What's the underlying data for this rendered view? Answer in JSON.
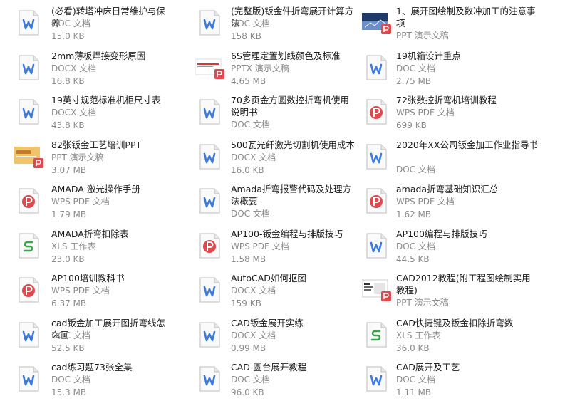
{
  "files": [
    {
      "title": "(必看)转塔冲床日常维护与保养",
      "type": "DOC 文档",
      "size": "15.0 KB",
      "icon": "word-doc-icon"
    },
    {
      "title": "(完整版)钣金件折弯展开计算方法",
      "type": "DOC 文档",
      "size": "158 KB",
      "icon": "word-doc-icon"
    },
    {
      "title": "1、展开图绘制及数冲加工的注意事项",
      "type": "PPT 演示文稿",
      "size": "",
      "icon": "ppt-thumbnail-icon"
    },
    {
      "title": "2mm薄板焊接变形原因",
      "type": "DOCX 文档",
      "size": "16.8 KB",
      "icon": "word-doc-icon"
    },
    {
      "title": "6S管理定置划线颜色及标准",
      "type": "PPTX 演示文稿",
      "size": "4.65 MB",
      "icon": "ppt-thumbnail-icon"
    },
    {
      "title": "19机箱设计重点",
      "type": "DOC 文档",
      "size": "2.75 MB",
      "icon": "word-doc-icon"
    },
    {
      "title": "19英寸规范标准机柜尺寸表",
      "type": "DOCX 文档",
      "size": "43.8 KB",
      "icon": "word-doc-icon"
    },
    {
      "title": "70多页金方圆数控折弯机使用说明书",
      "type": "DOC 文档",
      "size": "",
      "icon": "word-doc-icon"
    },
    {
      "title": "72张数控折弯机培训教程",
      "type": "WPS PDF 文档",
      "size": "699 KB",
      "icon": "pdf-icon"
    },
    {
      "title": "82张钣金工艺培训PPT",
      "type": "PPT 演示文稿",
      "size": "3.07 MB",
      "icon": "ppt-thumbnail-icon"
    },
    {
      "title": "500瓦光纤激光切割机使用成本",
      "type": "DOCX 文档",
      "size": "16.0 KB",
      "icon": "word-doc-icon"
    },
    {
      "title": "2020年XX公司钣金加工作业指导书",
      "type": "DOC 文档",
      "size": "",
      "icon": "word-doc-icon"
    },
    {
      "title": "AMADA 激光操作手册",
      "type": "WPS PDF 文档",
      "size": "1.79 MB",
      "icon": "pdf-icon"
    },
    {
      "title": "Amada折弯报警代码及处理方法概要",
      "type": "DOC 文档",
      "size": "",
      "icon": "word-doc-icon"
    },
    {
      "title": "amada折弯基础知识汇总",
      "type": "WPS PDF 文档",
      "size": "1.62 MB",
      "icon": "pdf-icon"
    },
    {
      "title": "AMADA折弯扣除表",
      "type": "XLS 工作表",
      "size": "23.0 KB",
      "icon": "excel-sheet-icon"
    },
    {
      "title": "AP100-钣金编程与排版技巧",
      "type": "WPS PDF 文档",
      "size": "1.58 MB",
      "icon": "pdf-icon"
    },
    {
      "title": "AP100编程与排版技巧",
      "type": "DOC 文档",
      "size": "44.5 KB",
      "icon": "word-doc-icon"
    },
    {
      "title": "AP100培训教科书",
      "type": "WPS PDF 文档",
      "size": "6.37 MB",
      "icon": "pdf-icon"
    },
    {
      "title": "AutoCAD如何抠图",
      "type": "DOCX 文档",
      "size": "159 KB",
      "icon": "word-doc-icon"
    },
    {
      "title": "CAD2012教程(附工程图绘制实用教程)",
      "type": "PPT 演示文稿",
      "size": "",
      "icon": "ppt-thumbnail-icon"
    },
    {
      "title": "cad钣金加工展开图折弯线怎么画",
      "type": "DOC 文档",
      "size": "52.5 KB",
      "icon": "word-doc-icon"
    },
    {
      "title": "CAD钣金展开实练",
      "type": "DOCX 文档",
      "size": "0.99 MB",
      "icon": "word-doc-icon"
    },
    {
      "title": "CAD快捷键及钣金扣除折弯数",
      "type": "XLS 工作表",
      "size": "36.0 KB",
      "icon": "excel-sheet-icon"
    },
    {
      "title": "cad练习题73张全集",
      "type": "DOC 文档",
      "size": "15.3 MB",
      "icon": "word-doc-icon"
    },
    {
      "title": "CAD-圆台展开教程",
      "type": "DOC 文档",
      "size": "96.0 KB",
      "icon": "word-doc-icon"
    },
    {
      "title": "CAD展开及工艺",
      "type": "DOC 文档",
      "size": "1.11 MB",
      "icon": "word-doc-icon"
    }
  ],
  "colors": {
    "word": "#3b7be0",
    "pdf": "#e0484e",
    "excel": "#3aa64a",
    "ppt_badge": "#e0484e"
  }
}
